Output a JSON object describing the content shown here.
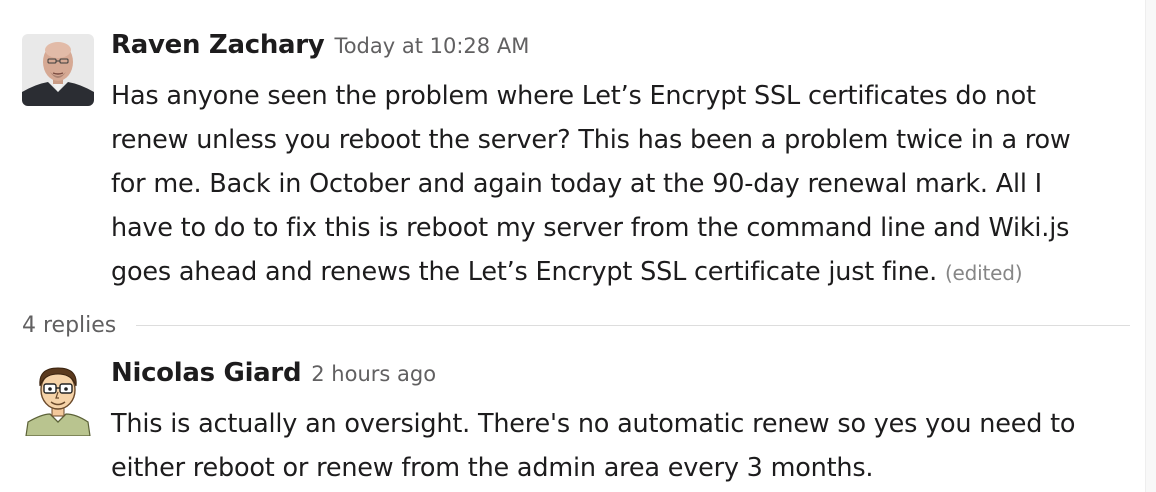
{
  "thread": {
    "parent": {
      "sender": "Raven Zachary",
      "timestamp": "Today at 10:28 AM",
      "text": "Has anyone seen the problem where Let’s Encrypt SSL certificates do not renew unless you reboot the server? This has been a problem twice in a row for me. Back in October and again today at the 90-day renewal mark. All I have to do to fix this is reboot my server from the command line and Wiki.js goes ahead and renews the Let’s Encrypt SSL certificate just fine.",
      "edited_label": "(edited)"
    },
    "replies_label": "4 replies",
    "reply": {
      "sender": "Nicolas Giard",
      "timestamp": "2 hours ago",
      "text": "This is actually an oversight. There's no automatic renew so yes you need to either reboot or renew from the admin area every 3 months."
    }
  },
  "colors": {
    "text_primary": "#1d1c1d",
    "text_secondary": "#616061",
    "edited": "#868686",
    "divider": "#dddddd"
  }
}
